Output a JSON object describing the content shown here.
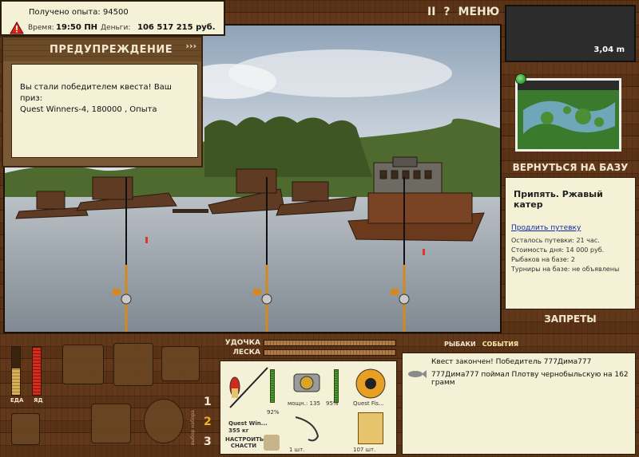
{
  "status": {
    "xp_text": "Получено опыта: 94500",
    "time_label": "Время:",
    "time_value": "19:50 ПН",
    "money_label": "Деньги:",
    "money_value": "106 517 215 руб."
  },
  "top_menu": {
    "pause": "II",
    "help": "?",
    "menu": "МЕНЮ"
  },
  "warning": {
    "title": "ПРЕДУПРЕЖДЕНИЕ",
    "arrows": "›››",
    "line1": "Вы стали победителем квеста! Ваш приз:",
    "line2": "Quest Winners-4, 180000 , Опыта"
  },
  "depth": {
    "value": "3,04 m"
  },
  "location": {
    "back_to_base": "ВЕРНУТЬСЯ НА БАЗУ",
    "title": "Припять. Ржавый катер",
    "extend_link": "Продлить путевку",
    "remaining": "Осталось путевки: 21 час.",
    "day_cost": "Стоимость дня: 14 000 руб.",
    "fishers": "Рыбаков на базе: 2",
    "tournaments": "Турниры на базе: не объявлены",
    "bans": "ЗАПРЕТЫ"
  },
  "bars": {
    "rod_label": "УДОЧКА",
    "line_label": "ЛЕСКА"
  },
  "needs": {
    "food_label": "ЕДА",
    "poison_label": "ЯД",
    "food_level": 0.55,
    "poison_level": 0.98
  },
  "slots": {
    "one": "1",
    "two": "2",
    "three": "3",
    "vertical": "выбор набора"
  },
  "tackle": {
    "rod_name": "Quest Win...",
    "rod_weight": "355 кг",
    "rod_percent": "92%",
    "reel_power": "мощн.: 135",
    "reel_percent": "95%",
    "line_name": "Quest Fis...",
    "hook_count": "1 шт.",
    "bait_count": "107 шт.",
    "configure": "НАСТРОИТЬ\nСНАСТИ"
  },
  "events": {
    "tab_fishers": "РЫБАКИ",
    "tab_events": "СОБЫТИЯ",
    "line1": "Квест закончен! Победитель 777Дима777",
    "line2": "777Дима777 поймал Плотву чернобыльскую на 162 грамм"
  },
  "colors": {
    "accent_text": "#f3e8cf",
    "panel": "#f4f1d6",
    "wood": "#5a3215",
    "link": "#0d2aa8"
  }
}
